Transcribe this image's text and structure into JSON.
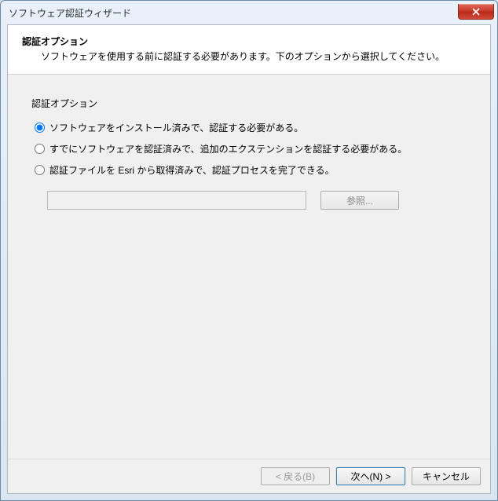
{
  "window": {
    "title": "ソフトウェア認証ウィザード"
  },
  "header": {
    "title": "認証オプション",
    "subtitle": "ソフトウェアを使用する前に認証する必要があります。下のオプションから選択してください。"
  },
  "group": {
    "label": "認証オプション"
  },
  "options": [
    {
      "label": "ソフトウェアをインストール済みで、認証する必要がある。",
      "selected": true
    },
    {
      "label": "すでにソフトウェアを認証済みで、追加のエクステンションを認証する必要がある。",
      "selected": false
    },
    {
      "label": "認証ファイルを Esri から取得済みで、認証プロセスを完了できる。",
      "selected": false
    }
  ],
  "file": {
    "value": "",
    "browse_label": "参照..."
  },
  "footer": {
    "back_label": "< 戻る(B)",
    "next_label": "次へ(N) >",
    "cancel_label": "キャンセル"
  }
}
